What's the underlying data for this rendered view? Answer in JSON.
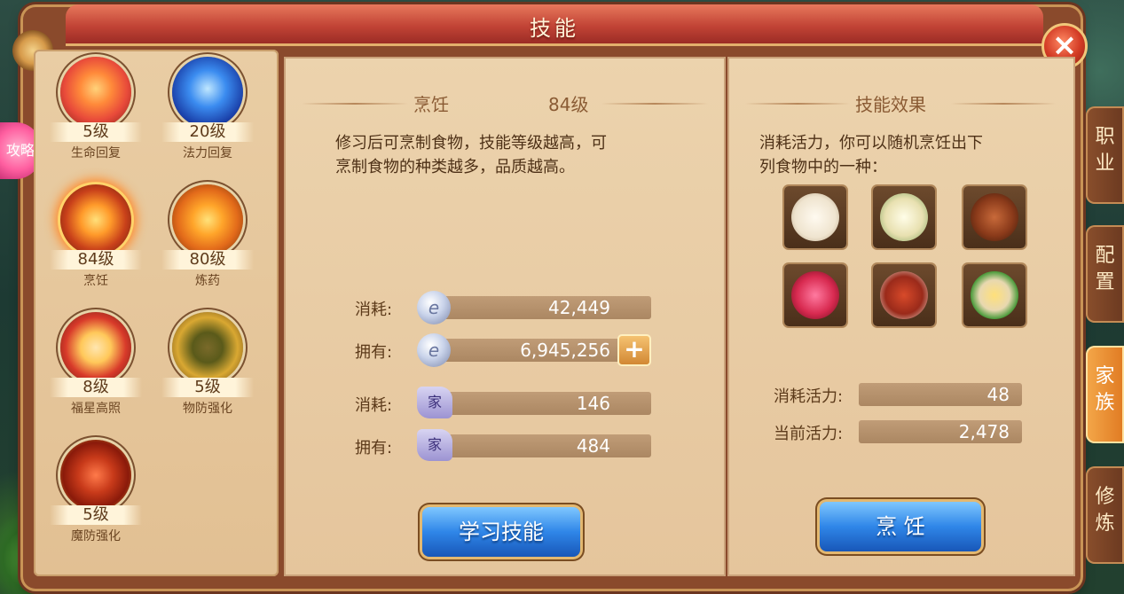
{
  "title": "技能",
  "close_icon": "close-x-icon",
  "guide": {
    "label": "攻略"
  },
  "skills": [
    {
      "level": "5级",
      "name": "生命回复",
      "icon": "peach-icon",
      "color": "#e84a3a"
    },
    {
      "level": "20级",
      "name": "法力回复",
      "icon": "blue-orb-icon",
      "color": "#2a5fd8"
    },
    {
      "level": "84级",
      "name": "烹饪",
      "icon": "cooking-pot-icon",
      "color": "#c8401a",
      "selected": true
    },
    {
      "level": "80级",
      "name": "炼药",
      "icon": "cauldron-icon",
      "color": "#e26a1a"
    },
    {
      "level": "8级",
      "name": "福星高照",
      "icon": "lucky-star-icon",
      "color": "#d83a2a"
    },
    {
      "level": "5级",
      "name": "物防强化",
      "icon": "shield-icon",
      "color": "#d9a832"
    },
    {
      "level": "5级",
      "name": "魔防强化",
      "icon": "magic-shield-icon",
      "color": "#b82a1a"
    }
  ],
  "detail": {
    "skill_name": "烹饪",
    "skill_level": "84级",
    "description_line1": "修习后可烹制食物，技能等级越高，可",
    "description_line2": "烹制食物的种类越多，品质越高。",
    "cost_label": "消耗:",
    "own_label": "拥有:",
    "silver_cost": "42,449",
    "silver_own": "6,945,256",
    "contrib_cost": "146",
    "contrib_own": "484",
    "contrib_icon_text": "家",
    "learn_button": "学习技能"
  },
  "effect": {
    "heading": "技能效果",
    "text_line1": "消耗活力，你可以随机烹饪出下",
    "text_line2": "列食物中的一种：",
    "foods": [
      "steamed-bun-icon",
      "porridge-icon",
      "soup-icon",
      "wine-jar-icon",
      "braised-pork-icon",
      "noodles-icon"
    ],
    "vitality_cost_label": "消耗活力:",
    "vitality_cost": "48",
    "vitality_current_label": "当前活力:",
    "vitality_current": "2,478",
    "cook_button": "烹 饪"
  },
  "tabs": [
    {
      "label": "职\n业",
      "active": false
    },
    {
      "label": "配\n置",
      "active": false
    },
    {
      "label": "家\n族",
      "active": true
    },
    {
      "label": "修\n炼",
      "active": false
    }
  ]
}
